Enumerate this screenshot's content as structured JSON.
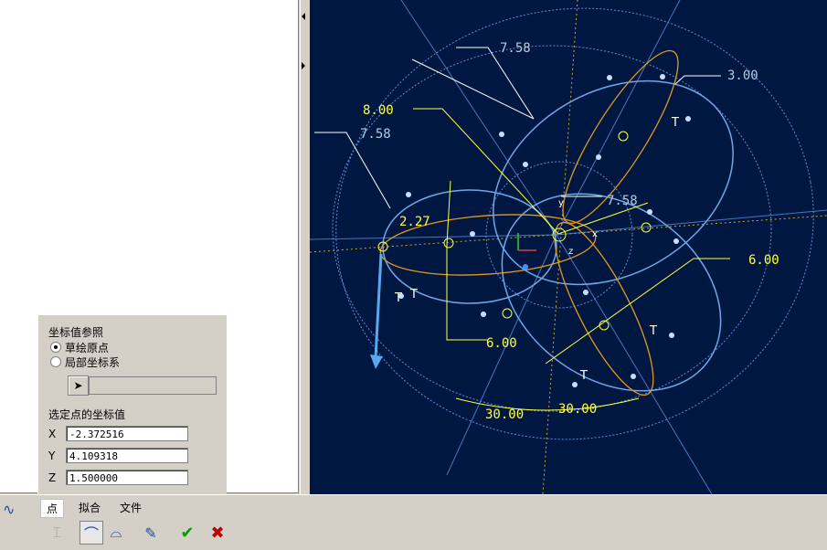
{
  "viewport": {
    "dimensions": [
      {
        "id": "d1",
        "text": "7.58"
      },
      {
        "id": "d2",
        "text": "3.00"
      },
      {
        "id": "d3",
        "text": "8.00"
      },
      {
        "id": "d4",
        "text": "7.58"
      },
      {
        "id": "d5",
        "text": "7.58"
      },
      {
        "id": "d6",
        "text": "2.27"
      },
      {
        "id": "d7",
        "text": "6.00"
      },
      {
        "id": "d8",
        "text": "6.00"
      },
      {
        "id": "d9",
        "text": "30.00"
      },
      {
        "id": "d10",
        "text": "30.00"
      }
    ],
    "axis_labels": {
      "y": "y",
      "x": "x",
      "z": "z"
    },
    "tangent_marks": [
      "T",
      "T",
      "T",
      "T",
      "T"
    ]
  },
  "coord_panel": {
    "reference_title": "坐标值参照",
    "option_sketch_origin": "草绘原点",
    "option_local_csys": "局部坐标系",
    "selected_title": "选定点的坐标值",
    "x_label": "X",
    "x_value": "-2.372516",
    "y_label": "Y",
    "y_value": "4.109318",
    "z_label": "Z",
    "z_value": "1.500000"
  },
  "bottom": {
    "tabs": [
      "点",
      "拟合",
      "文件"
    ],
    "active_tab": "点"
  },
  "colors": {
    "viewport_bg": "#001841",
    "sketch": "#ffffff",
    "dim": "#ffff00",
    "construction": "#5a8fd8",
    "accent_check": "#00a000",
    "accent_cross": "#c00000"
  }
}
